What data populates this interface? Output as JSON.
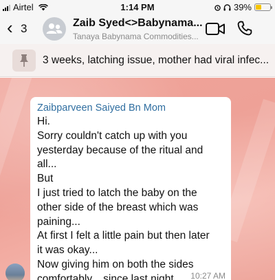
{
  "status_bar": {
    "carrier": "Airtel",
    "time": "1:14 PM",
    "battery": "39%",
    "battery_level": 0.39
  },
  "header": {
    "back_count": "3",
    "title": "Zaib Syed<>Babynama...",
    "subtitle": "Tanaya Babynama Commodities..."
  },
  "pinned": {
    "text": "3 weeks, latching issue, mother had viral infec..."
  },
  "message": {
    "sender": "Zaibparveen Saiyed Bn Mom",
    "lines": [
      "Hi.",
      "Sorry couldn't catch up with you",
      "yesterday because of the ritual and",
      "all...",
      "But",
      "I just tried to latch the baby on the",
      "other side of the breast which was",
      "paining...",
      "At first I felt a little pain but then later",
      "it was okay...",
      "Now giving him on both the sides",
      "comfortably... since last night."
    ],
    "time": "10:27 AM"
  },
  "colors": {
    "header_bg": "#f6f6f6",
    "chat_bg": "#eea197",
    "sender_name": "#2f6ea0",
    "battery_fill": "#f5c400"
  },
  "icons": {
    "back": "chevron-left-icon",
    "avatar": "group-icon",
    "video": "video-camera-icon",
    "call": "phone-icon",
    "pin": "pin-icon"
  }
}
